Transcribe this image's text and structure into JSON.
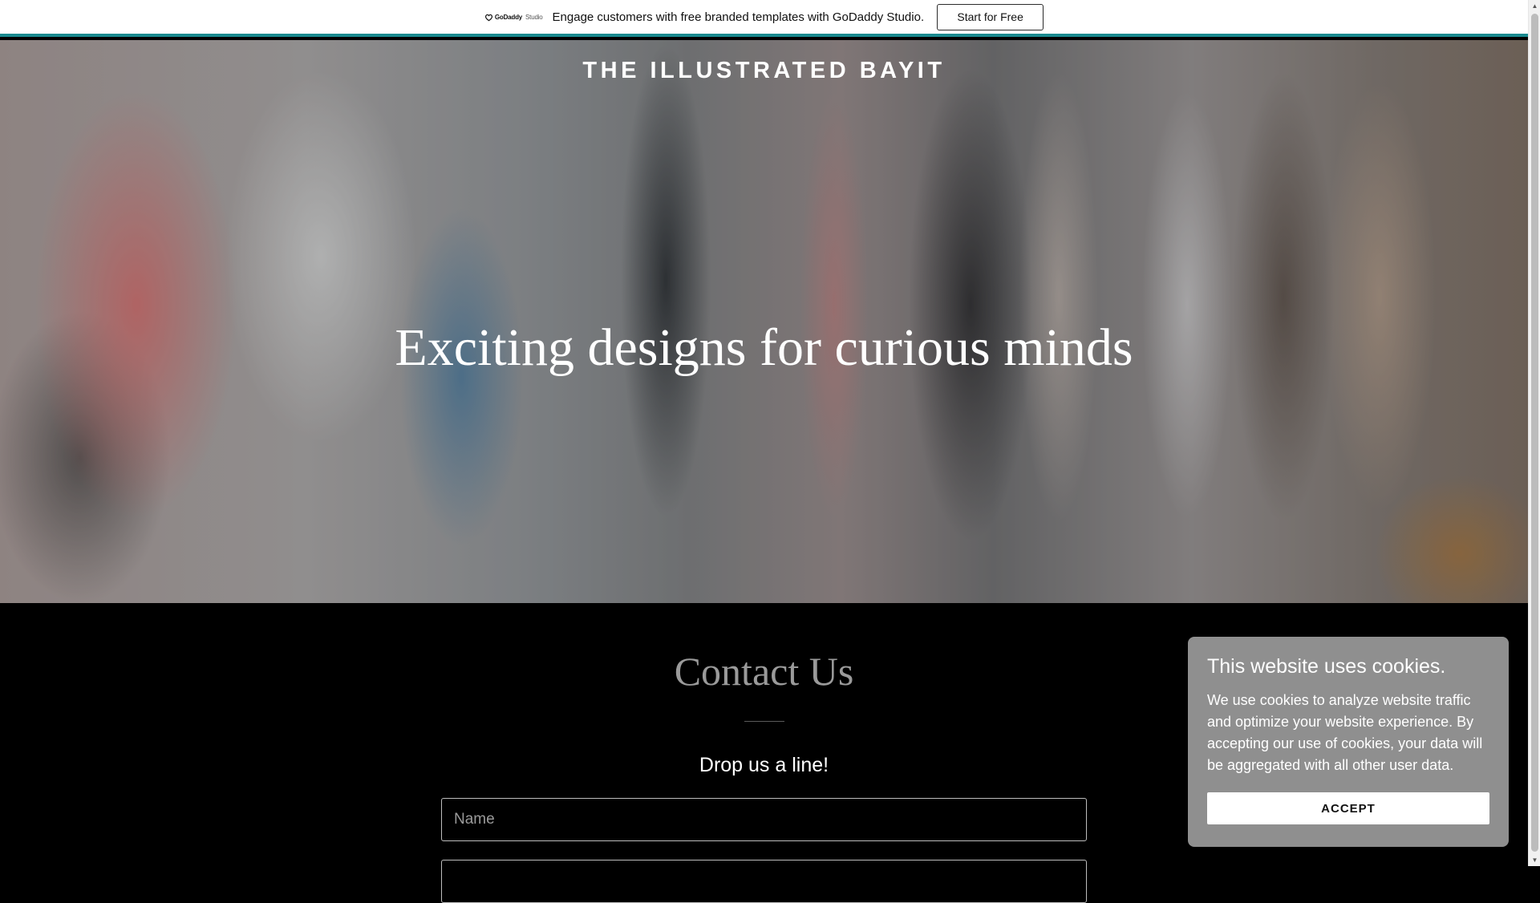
{
  "promo_bar": {
    "logo_text": "GoDaddy",
    "logo_sub": "Studio",
    "logo_icon": "godaddy-heart-icon",
    "message": "Engage customers with free branded templates with GoDaddy Studio.",
    "cta_label": "Start for Free",
    "accent_color": "#1a8a8f"
  },
  "hero": {
    "site_title": "THE ILLUSTRATED BAYIT",
    "headline": "Exciting designs for curious minds"
  },
  "contact": {
    "title": "Contact Us",
    "subtitle": "Drop us a line!",
    "name_placeholder": "Name",
    "email_value": ""
  },
  "cookie_banner": {
    "title": "This website uses cookies.",
    "body": "We use cookies to analyze website traffic and optimize your website experience. By accepting our use of cookies, your data will be aggregated with all other user data.",
    "accept_label": "ACCEPT",
    "panel_color": "#8f8f8f"
  },
  "scrollbar": {
    "up_icon": "scroll-up-arrow-icon",
    "down_icon": "scroll-down-arrow-icon"
  }
}
